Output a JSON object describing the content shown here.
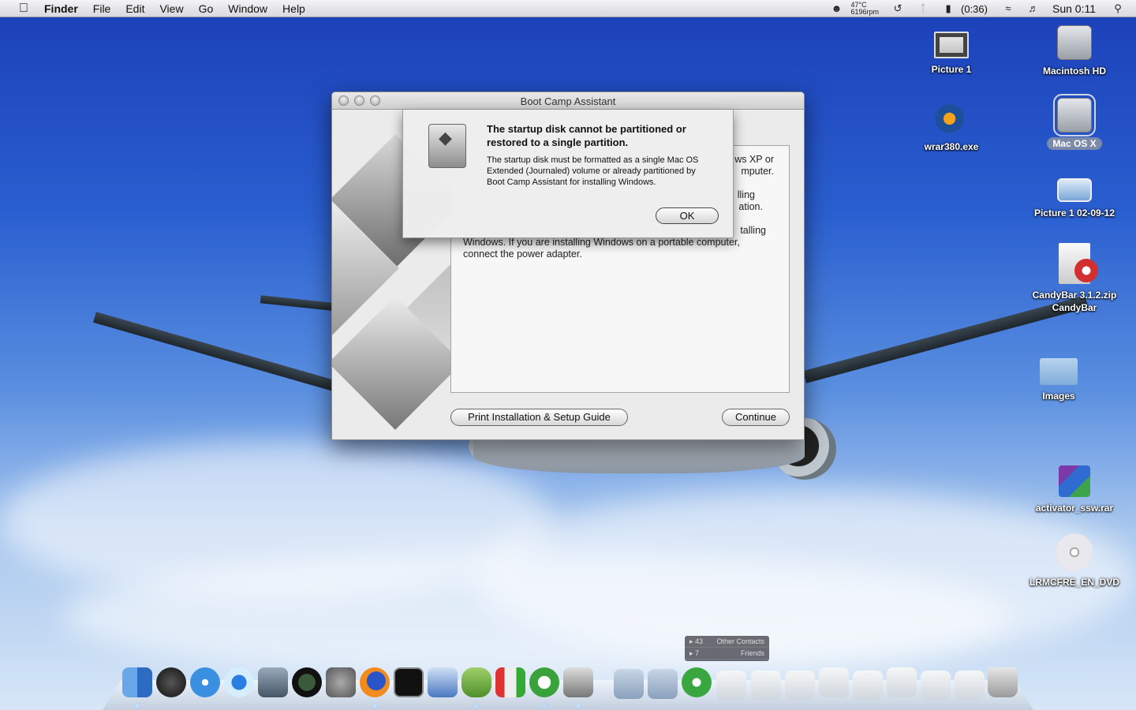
{
  "menubar": {
    "app": "Finder",
    "menus": [
      "File",
      "Edit",
      "View",
      "Go",
      "Window",
      "Help"
    ],
    "temp_line1": "47°C",
    "temp_line2": "6196rpm",
    "battery": "(0:36)",
    "clock": "Sun 0:11",
    "icons": [
      "apple-icon",
      "temperature-fan-icon",
      "time-machine-icon",
      "bluetooth-icon",
      "battery-icon",
      "wifi-icon",
      "volume-icon",
      "spotlight-icon"
    ]
  },
  "desktop": {
    "icons": [
      {
        "label": "Picture 1",
        "type": "screen"
      },
      {
        "label": "Macintosh HD",
        "type": "disk"
      },
      {
        "label": "wrar380.exe",
        "type": "wrar"
      },
      {
        "label": "Mac OS X",
        "type": "disk-selected"
      },
      {
        "label": "Picture 1 02-09-12",
        "type": "picture"
      },
      {
        "label": "CandyBar 3.1.2.zip",
        "label2": "CandyBar",
        "type": "zip"
      },
      {
        "label": "Images",
        "type": "folder"
      },
      {
        "label": "activator_ssw.rar",
        "type": "rar"
      },
      {
        "label": "LRMCFRE_EN_DVD",
        "type": "dvd"
      }
    ]
  },
  "window": {
    "title": "Boot Camp Assistant",
    "body": {
      "line1_tail": "ws XP or",
      "line2_tail": "mputer.",
      "line3_tail": "lling",
      "line4_tail": "ation.",
      "line5_tail": "talling",
      "line6": "Windows. If you are installing Windows on a portable computer,",
      "line7": "connect the power adapter."
    },
    "buttons": {
      "print": "Print Installation & Setup Guide",
      "continue": "Continue"
    }
  },
  "alert": {
    "heading": "The startup disk cannot be partitioned or restored to a single partition.",
    "message": "The startup disk must be formatted as a single Mac OS Extended (Journaled) volume or already partitioned by Boot Camp Assistant for installing Windows.",
    "ok": "OK"
  },
  "chat": {
    "row1_count": "43",
    "row1_label": "Other Contacts",
    "row2_count": "7",
    "row2_label": "Friends"
  }
}
